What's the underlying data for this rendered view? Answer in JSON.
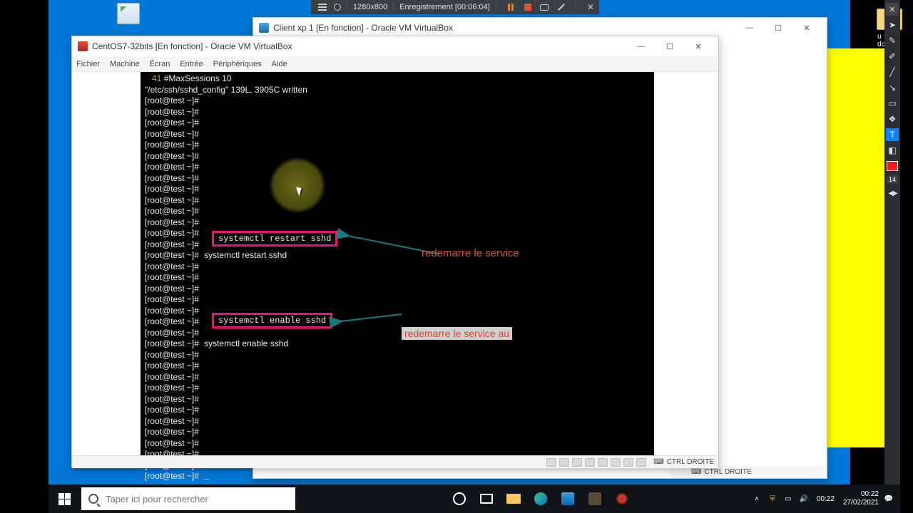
{
  "recbar": {
    "resolution": "1280x800",
    "label": "Enregistrement",
    "time": "[00:06:04]"
  },
  "desktop": {
    "recycle_tip": "Corbeille",
    "folder_label": "u dc"
  },
  "back_window": {
    "title": "Client xp 1 [En fonction] - Oracle VM VirtualBox",
    "status_key": "CTRL DROITE"
  },
  "front_window": {
    "title": "CentOS7-32bits [En fonction] - Oracle VM VirtualBox",
    "menu": [
      "Fichier",
      "Machine",
      "Écran",
      "Entrée",
      "Périphériques",
      "Aide"
    ],
    "status_key": "CTRL DROITE"
  },
  "terminal": {
    "first_line_num": "   41",
    "first_line_txt": " #MaxSessions 10",
    "written": "\"/etc/ssh/sshd_config\" 139L, 3905C written",
    "prompt": "[root@test ~]#",
    "cmd1": "systemctl restart sshd",
    "cmd2": "systemctl enable sshd"
  },
  "annotations": {
    "note1": "redemarre le service",
    "note2": "redemarre le service au "
  },
  "right_toolbar": {
    "num": "14"
  },
  "taskbar": {
    "search_placeholder": "Taper ici pour rechercher",
    "clock_time": "00:22",
    "clock_date": "27/02/2021",
    "tray_time": "00:22"
  }
}
